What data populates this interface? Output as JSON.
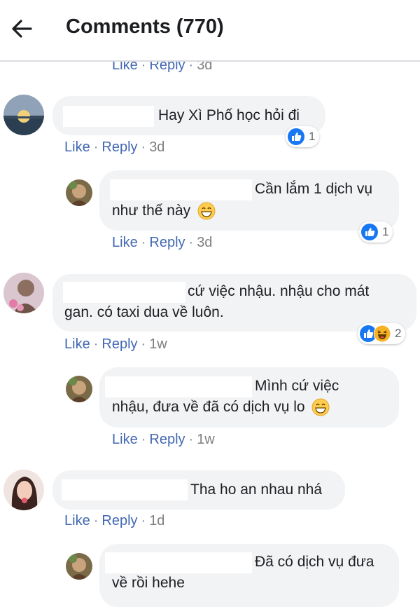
{
  "header": {
    "title": "Comments (770)"
  },
  "labels": {
    "like": "Like",
    "reply": "Reply",
    "sep": "·"
  },
  "top_partial": {
    "time": "3d"
  },
  "comments": [
    {
      "text": "Hay Xì Phố học hỏi đi",
      "time": "3d",
      "reaction_count": "1",
      "reactions": [
        "like-icon"
      ]
    },
    {
      "lines": [
        "Cần lắm 1 dịch vụ",
        "như thế này"
      ],
      "time": "3d",
      "reaction_count": "1",
      "reactions": [
        "like-icon"
      ]
    },
    {
      "lines": [
        "cứ việc nhậu. nhậu cho mát",
        "gan. có taxi dua về luôn."
      ],
      "time": "1w",
      "reaction_count": "2",
      "reactions": [
        "like-icon",
        "haha-icon"
      ]
    },
    {
      "lines": [
        "Mình cứ việc",
        "nhậu, đưa về đã có dịch vụ lo"
      ],
      "time": "1w"
    },
    {
      "text": "Tha ho an nhau nhá",
      "time": "1d"
    },
    {
      "lines": [
        "Đã có dịch vụ đưa",
        "về rồi hehe"
      ]
    }
  ],
  "colors": {
    "link": "#4267b2",
    "bubble": "#f2f3f5",
    "like_blue": "#1877f2",
    "haha_yellow": "#f7b125"
  }
}
